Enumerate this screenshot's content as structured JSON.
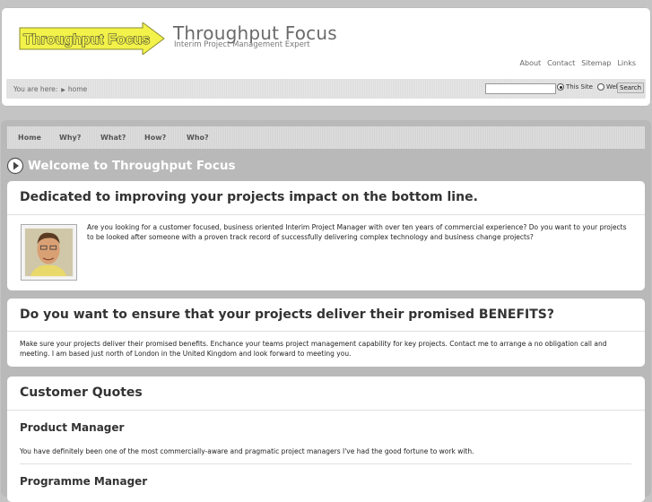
{
  "header": {
    "logo_text": "Throughput Focus",
    "title": "Throughput Focus",
    "tagline": "Interim Project Management Expert",
    "links": [
      "About",
      "Contact",
      "Sitemap",
      "Links"
    ]
  },
  "breadcrumb": {
    "label": "You are here:",
    "current": "home"
  },
  "search": {
    "value": "",
    "option_this_site": "This Site",
    "option_web": "Web",
    "selected": "This Site",
    "button": "Search"
  },
  "nav": [
    "Home",
    "Why?",
    "What?",
    "How?",
    "Who?"
  ],
  "welcome": "Welcome to Throughput Focus",
  "section1": {
    "heading": "Dedicated to improving your projects impact on the bottom line.",
    "text": "Are you looking for a customer focused, business oriented Interim Project Manager with over ten years of commercial experience? Do you want to your projects to be looked after someone with a proven track record of successfully delivering complex technology and business change projects?"
  },
  "section2": {
    "heading": "Do you want to ensure that your projects deliver their promised BENEFITS?",
    "text": "Make sure your projects deliver their promised benefits. Enchance your teams project management capability for key projects. Contact me to arrange a no obligation call and meeting. I am based just north of London in the United Kingdom and look forward to meeting you."
  },
  "quotes": {
    "heading": "Customer Quotes",
    "items": [
      {
        "role": "Product Manager",
        "text": "You have definitely been one of the most commercially-aware and pragmatic project managers I've had the good fortune to work with."
      },
      {
        "role": "Programme Manager"
      }
    ]
  },
  "colors": {
    "logo_yellow": "#f2f24a",
    "page_bg": "#c4c4c4",
    "heading": "#333333"
  }
}
